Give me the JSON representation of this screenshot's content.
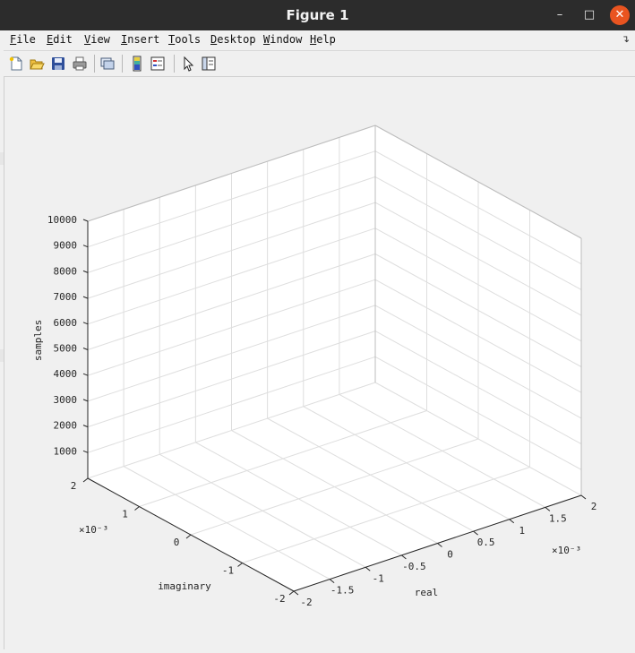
{
  "window": {
    "title": "Figure 1",
    "minimize_icon": "minimize-icon",
    "maximize_icon": "maximize-icon",
    "close_icon": "close-icon"
  },
  "menu": [
    "File",
    "Edit",
    "View",
    "Insert",
    "Tools",
    "Desktop",
    "Window",
    "Help"
  ],
  "toolbar": [
    "new-figure-icon",
    "open-file-icon",
    "save-icon",
    "print-icon",
    "link-plot-icon",
    "insert-colorbar-icon",
    "insert-legend-icon",
    "edit-plot-arrow-icon",
    "property-inspector-icon"
  ],
  "chart_data": {
    "type": "line3d",
    "title": "",
    "xlabel": "real",
    "ylabel": "imaginary",
    "zlabel": "samples",
    "xlim": [
      -0.002,
      0.002
    ],
    "ylim": [
      -0.002,
      0.002
    ],
    "zlim": [
      0,
      10000
    ],
    "x_ticks": [
      "-2",
      "-1.5",
      "-1",
      "-0.5",
      "0",
      "0.5",
      "1",
      "1.5",
      "2"
    ],
    "y_ticks": [
      "-2",
      "-1",
      "0",
      "1",
      "2"
    ],
    "z_ticks": [
      "1000",
      "2000",
      "3000",
      "4000",
      "5000",
      "6000",
      "7000",
      "8000",
      "9000",
      "10000"
    ],
    "x_exponent": "×10⁻³",
    "y_exponent": "×10⁻³",
    "grid": true,
    "series": []
  }
}
